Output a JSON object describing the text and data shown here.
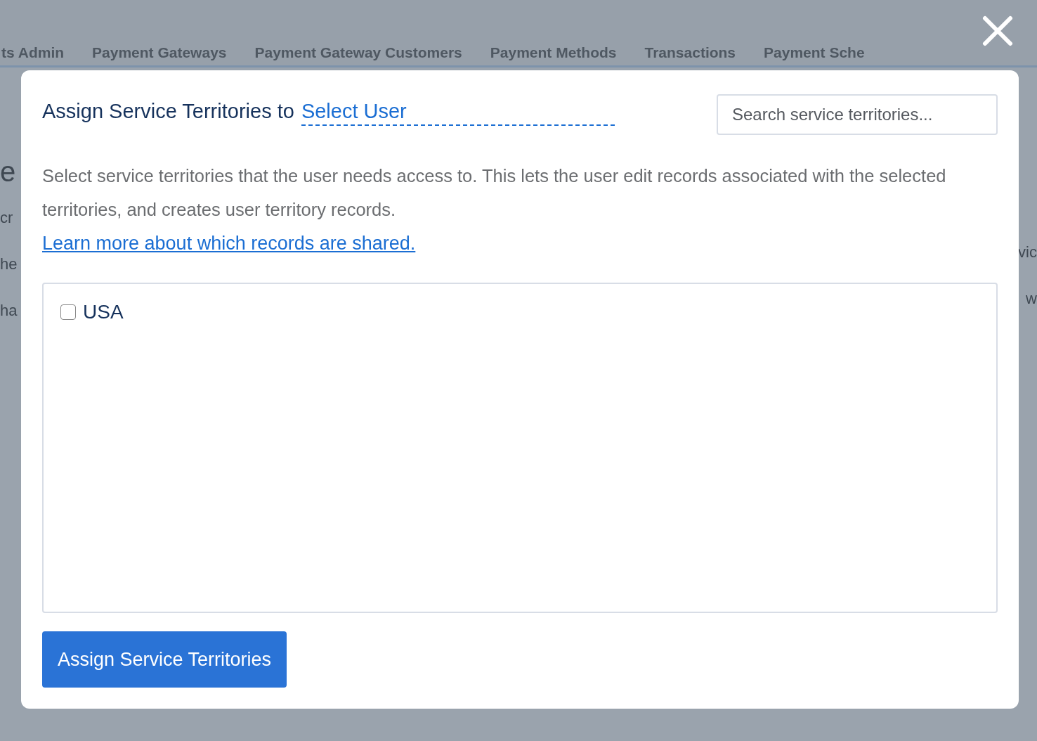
{
  "background": {
    "tabs": [
      {
        "label": "ts Admin"
      },
      {
        "label": "Payment Gateways"
      },
      {
        "label": "Payment Gateway Customers"
      },
      {
        "label": "Payment Methods"
      },
      {
        "label": "Transactions"
      },
      {
        "label": "Payment Sche"
      }
    ],
    "left_fragments": [
      "e",
      "cr",
      "he",
      "ha"
    ],
    "right_fragments": [
      "vic",
      "w"
    ]
  },
  "dialog": {
    "title": "Assign Service Territories to",
    "user_select": "Select User",
    "search": {
      "placeholder": "Search service territories..."
    },
    "description": "Select service territories that the user needs access to. This lets the user edit records associated with the selected territories, and creates user territory records.",
    "link": "Learn more about which records are shared.",
    "territories": [
      {
        "label": "USA",
        "checked": false
      }
    ],
    "button": "Assign Service Territories"
  }
}
